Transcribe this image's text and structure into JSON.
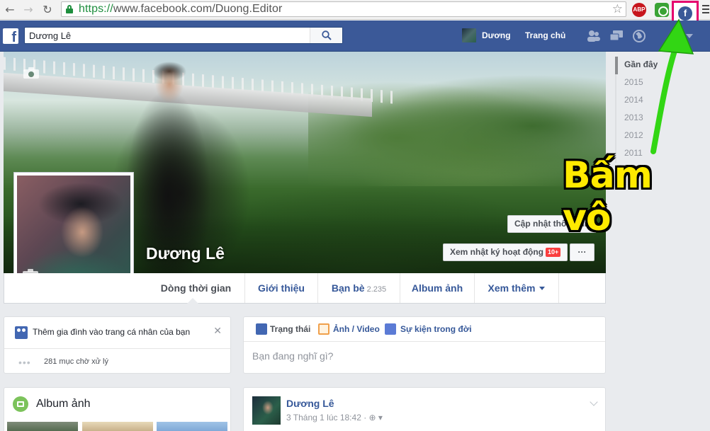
{
  "browser": {
    "url_scheme": "https://",
    "url_rest": "www.facebook.com/Duong.Editor",
    "abp_label": "ABP",
    "fb_ext_label": "f"
  },
  "topbar": {
    "logo": "f",
    "search_value": "Dương Lê",
    "profile_name": "Dương",
    "home_label": "Trang chủ"
  },
  "cover": {
    "name": "Dương Lê",
    "update_info": "Cập nhật thông tin",
    "activity_log": "Xem nhật ký hoạt động",
    "activity_badge": "10+",
    "more_dots": "···"
  },
  "tabs": [
    {
      "label": "Dòng thời gian"
    },
    {
      "label": "Giới thiệu"
    },
    {
      "label": "Bạn bè",
      "count": "2.235"
    },
    {
      "label": "Album ảnh"
    },
    {
      "label": "Xem thêm"
    }
  ],
  "years": [
    "Gần đây",
    "2015",
    "2014",
    "2013",
    "2012",
    "2011"
  ],
  "family_card": {
    "text": "Thêm gia đình vào trang cá nhân của bạn",
    "close": "✕",
    "pending_dots": "•••",
    "pending": "281 mục chờ xử lý"
  },
  "album_card": {
    "title": "Album ảnh"
  },
  "composer": {
    "status": "Trạng thái",
    "photo": "Ảnh / Video",
    "event": "Sự kiện trong đời",
    "placeholder": "Bạn đang nghĩ gì?"
  },
  "post": {
    "name": "Dương Lê",
    "time": "3 Tháng 1 lúc 18:42 · ",
    "audience_icon": "globe-icon"
  },
  "annotation": {
    "text": "Bấm vô",
    "color": "#ffea00",
    "arrow_color": "#32d614",
    "highlight_color": "#e5006d"
  }
}
